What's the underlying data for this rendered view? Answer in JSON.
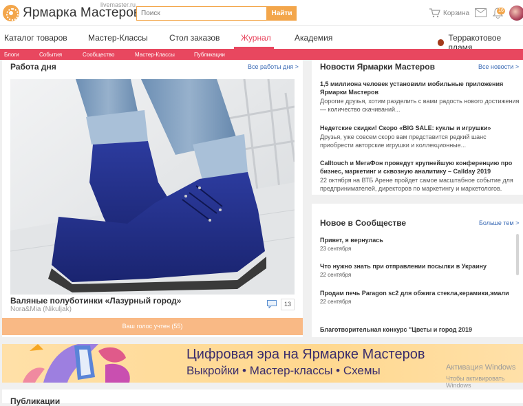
{
  "header": {
    "logo_text": "Ярмарка Мастеров",
    "logo_sub": "livemaster.ru",
    "search_placeholder": "Поиск",
    "search_button": "Найти",
    "cart_label": "Корзина",
    "notification_count": "16"
  },
  "nav": {
    "items": [
      "Каталог товаров",
      "Мастер-Классы",
      "Стол заказов",
      "Журнал",
      "Академия"
    ],
    "active": "Журнал",
    "right_label": "Терракотовое пламя"
  },
  "subnav": {
    "items": [
      "Блоги",
      "События",
      "Сообщество",
      "Мастер-Классы",
      "Публикации"
    ]
  },
  "work_of_day": {
    "title": "Работа дня",
    "link": "Все работы дня >",
    "item_title": "Валяные полуботинки «Лазурный город»",
    "item_author": "Nora&Mia (Nikuljak)",
    "comment_count": "13",
    "vote_label": "Ваш голос учтен (55)"
  },
  "news": {
    "title": "Новости Ярмарки Мастеров",
    "link": "Все новости >",
    "items": [
      {
        "title": "1,5 миллиона человек установили мобильные приложения Ярмарки Мастеров",
        "text": "Дорогие друзья, хотим разделить с вами радость нового достижения — количество скачиваний..."
      },
      {
        "title": "Недетские скидки! Скоро «BIG SALE: куклы и игрушки»",
        "text": "Друзья, уже совсем скоро вам представится редкий шанс приобрести авторские игрушки и коллекционные..."
      },
      {
        "title": "Calltouch и МегаФон проведут крупнейшую конференцию про бизнес, маркетинг и сквозную аналитику – Callday 2019",
        "text": "22 октября на ВТБ Арене пройдет самое масштабное событие для предпринимателей, директоров по маркетингу и маркетологов."
      }
    ]
  },
  "community": {
    "title": "Новое в Сообществе",
    "link": "Больше тем >",
    "items": [
      {
        "title": "Привет, я вернулась",
        "date": "23 сентября"
      },
      {
        "title": "Что нужно знать при отправлении посылки в Украину",
        "date": "22 сентября"
      },
      {
        "title": "Продам печь Paragon sc2 для обжига стекла,керамики,эмали",
        "date": "22 сентября"
      },
      {
        "title": "Благотворительная конкурс \"Цветы и город 2019",
        "date": ""
      }
    ]
  },
  "banner": {
    "title": "Цифровая эра на Ярмарке Мастеров",
    "subtitle": "Выкройки • Мастер-классы • Схемы"
  },
  "watermark": {
    "line1": "Активация Windows",
    "line2": "Чтобы активировать Windows"
  },
  "bottom": {
    "title": "Публикации"
  },
  "colors": {
    "accent": "#f3a64b",
    "brand_pink": "#e8475f",
    "link": "#3b6bb5"
  }
}
